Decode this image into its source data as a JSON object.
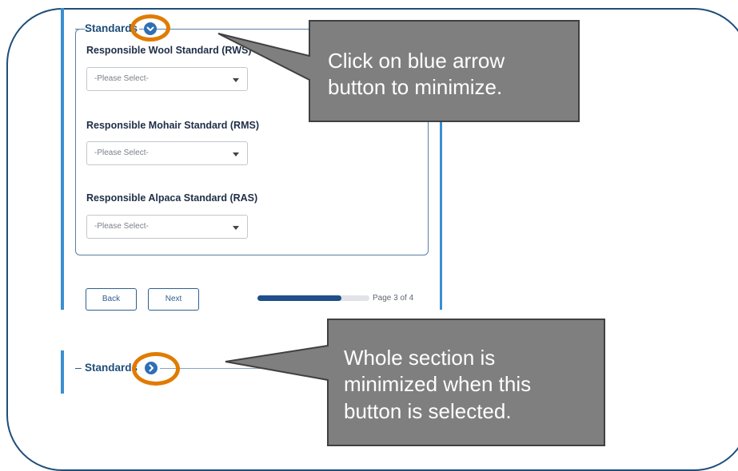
{
  "upper_form": {
    "legend": "Standards",
    "fields": [
      {
        "label": "Responsible Wool Standard (RWS)",
        "selected": "-Please Select-"
      },
      {
        "label": "Responsible Mohair Standard (RMS)",
        "selected": "-Please Select-"
      },
      {
        "label": "Responsible Alpaca Standard (RAS)",
        "selected": "-Please Select-"
      }
    ],
    "buttons": {
      "back": "Back",
      "next": "Next"
    },
    "progress": {
      "label": "Page 3 of 4",
      "fraction": 0.75
    }
  },
  "lower_form": {
    "legend": "Standards",
    "collapse_marker": "–"
  },
  "callouts": [
    {
      "text": "Click on blue arrow\nbutton to minimize."
    },
    {
      "text": "Whole section is\nminimized when this\nbutton is selected."
    }
  ],
  "colors": {
    "accent": "#2e6fb5",
    "highlight_ring": "#e07b00",
    "callout_bg": "#7f7f7f",
    "frame_border": "#1f4e79"
  },
  "icons": {
    "expanded": "chevron-down-icon",
    "collapsed": "chevron-right-icon"
  }
}
